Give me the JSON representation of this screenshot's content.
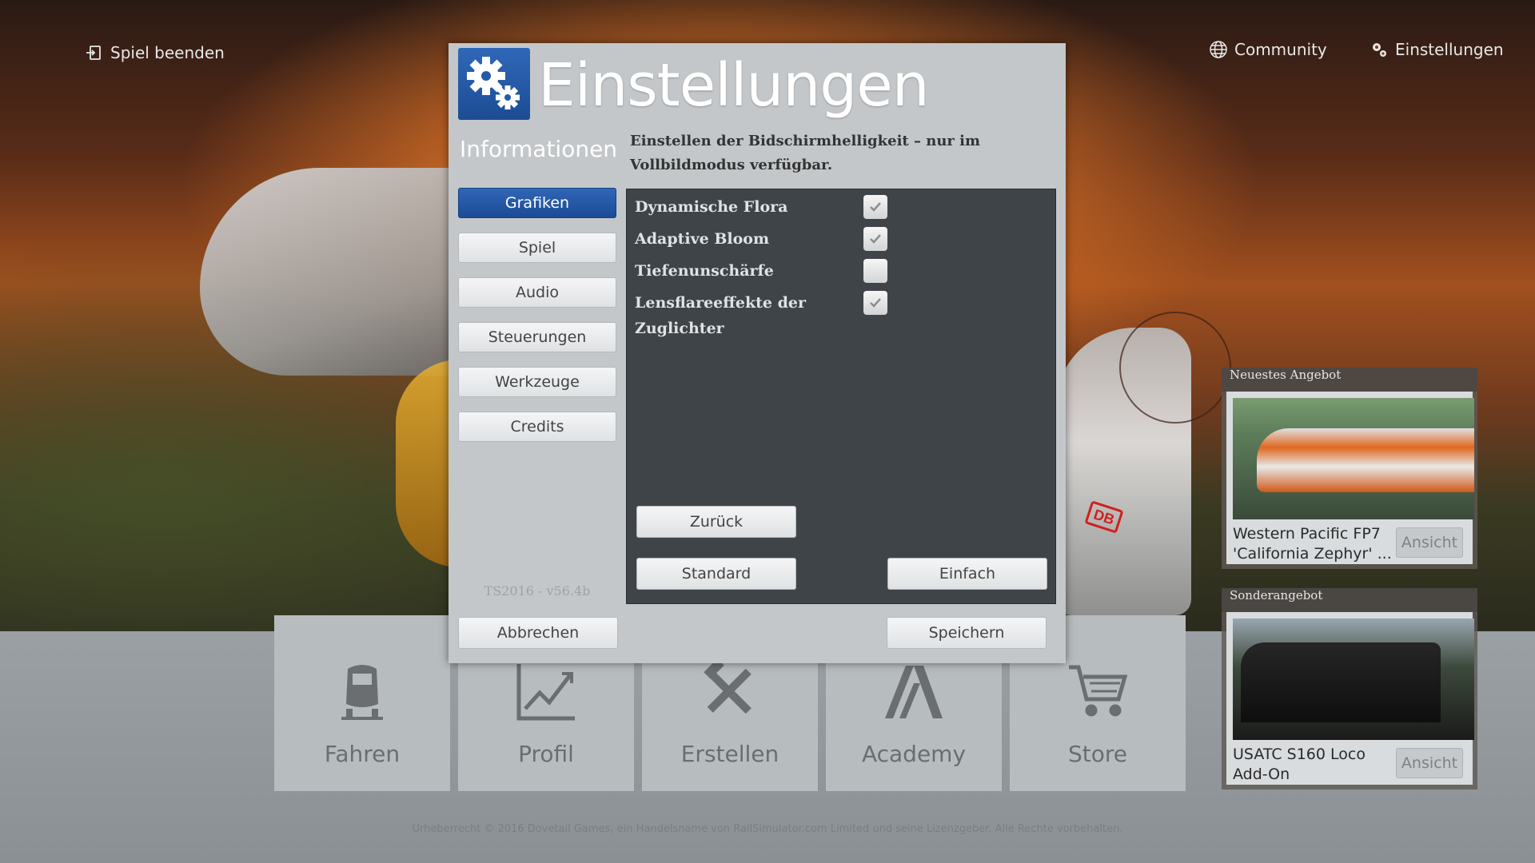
{
  "topnav": {
    "exit_label": "Spiel beenden",
    "community_label": "Community",
    "settings_label": "Einstellungen"
  },
  "dialog": {
    "title": "Einstellungen",
    "sidebar_heading": "Informationen",
    "sidebar_items": [
      {
        "label": "Grafiken",
        "active": true
      },
      {
        "label": "Spiel",
        "active": false
      },
      {
        "label": "Audio",
        "active": false
      },
      {
        "label": "Steuerungen",
        "active": false
      },
      {
        "label": "Werkzeuge",
        "active": false
      },
      {
        "label": "Credits",
        "active": false
      }
    ],
    "version": "TS2016 - v56.4b",
    "description": "Einstellen der Bidschirmhelligkeit – nur im Vollbildmodus verfügbar.",
    "options": [
      {
        "label": "Dynamische Flora",
        "checked": true
      },
      {
        "label": "Adaptive Bloom",
        "checked": true
      },
      {
        "label": "Tiefenunschärfe",
        "checked": false
      },
      {
        "label": "Lensflareeffekte der Zuglichter",
        "checked": true
      }
    ],
    "back_label": "Zurück",
    "default_label": "Standard",
    "simple_label": "Einfach",
    "cancel_label": "Abbrechen",
    "save_label": "Speichern",
    "accent_color": "#1f4f9a"
  },
  "tiles": [
    {
      "label": "Fahren",
      "icon": "train-icon"
    },
    {
      "label": "Profil",
      "icon": "chart-icon"
    },
    {
      "label": "Erstellen",
      "icon": "tools-icon"
    },
    {
      "label": "Academy",
      "icon": "academy-icon"
    },
    {
      "label": "Store",
      "icon": "cart-icon"
    }
  ],
  "offers": [
    {
      "heading": "Neuestes Angebot",
      "name": "Western Pacific FP7 'California Zephyr' ...",
      "view_label": "Ansicht"
    },
    {
      "heading": "Sonderangebot",
      "name": "USATC S160 Loco Add-On",
      "view_label": "Ansicht"
    }
  ],
  "copyright": "Urheberrecht © 2016 Dovetail Games, ein Handelsname von RailSimulator.com Limited und seine Lizenzgeber. Alle Rechte vorbehalten."
}
